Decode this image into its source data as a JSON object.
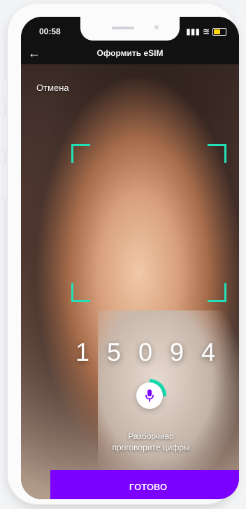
{
  "status": {
    "time": "00:58"
  },
  "header": {
    "title": "Оформить eSIM",
    "back_icon": "arrow-left-icon"
  },
  "screen": {
    "cancel_label": "Отмена"
  },
  "code": {
    "digits": [
      "1",
      "5",
      "0",
      "9",
      "4"
    ]
  },
  "voice": {
    "mic_icon": "microphone-icon",
    "hint_line1": "Разборчиво",
    "hint_line2": "проговорите цифры"
  },
  "actions": {
    "done_label": "ГОТОВО"
  },
  "colors": {
    "accent": "#7B00FF",
    "frame": "#24E0B6",
    "ring": "#18DFB4"
  }
}
